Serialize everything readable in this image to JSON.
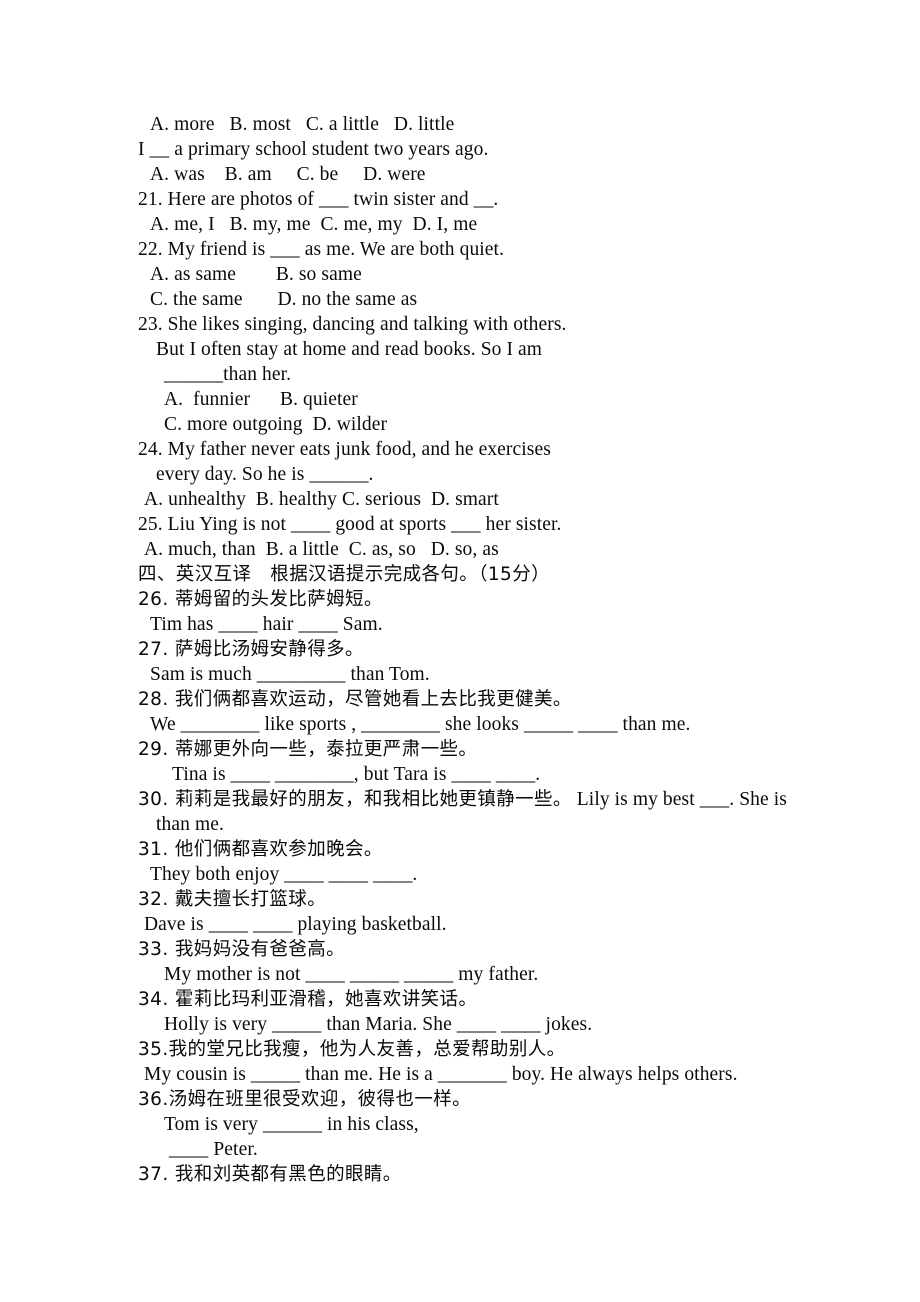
{
  "document": {
    "type": "english-exam-worksheet",
    "page_background": "#ffffff",
    "text_color": "#0a0a0a"
  },
  "lines": [
    {
      "id": "l01",
      "indent": 3,
      "script": "en",
      "text": "A. more   B. most   C. a little   D. little"
    },
    {
      "id": "l02",
      "indent": 1,
      "script": "en",
      "text": "I __ a primary school student two years ago."
    },
    {
      "id": "l03",
      "indent": 3,
      "script": "en",
      "text": "A. was    B. am     C. be     D. were"
    },
    {
      "id": "l04",
      "indent": 1,
      "script": "en",
      "text": "21. Here are photos of ___ twin sister and __."
    },
    {
      "id": "l05",
      "indent": 3,
      "script": "en",
      "text": "A. me, I   B. my, me  C. me, my  D. I, me"
    },
    {
      "id": "l06",
      "indent": 1,
      "script": "en",
      "text": "22. My friend is ___ as me. We are both quiet."
    },
    {
      "id": "l07",
      "indent": 3,
      "script": "en",
      "text": "A. as same        B. so same"
    },
    {
      "id": "l08",
      "indent": 3,
      "script": "en",
      "text": "C. the same       D. no the same as"
    },
    {
      "id": "l09",
      "indent": 1,
      "script": "en",
      "text": "23. She likes singing, dancing and talking with others."
    },
    {
      "id": "l10",
      "indent": 4,
      "script": "en",
      "text": "But I often stay at home and read books. So I am"
    },
    {
      "id": "l11",
      "indent": 5,
      "script": "en",
      "text": "______than her."
    },
    {
      "id": "l12",
      "indent": 5,
      "script": "en",
      "text": "A.  funnier      B. quieter"
    },
    {
      "id": "l13",
      "indent": 5,
      "script": "en",
      "text": "C. more outgoing  D. wilder"
    },
    {
      "id": "l14",
      "indent": 1,
      "script": "en",
      "text": "24. My father never eats junk food, and he exercises"
    },
    {
      "id": "l15",
      "indent": 4,
      "script": "en",
      "text": "every day. So he is ______."
    },
    {
      "id": "l16",
      "indent": 2,
      "script": "en",
      "text": "A. unhealthy  B. healthy C. serious  D. smart"
    },
    {
      "id": "l17",
      "indent": 1,
      "script": "en",
      "text": "25. Liu Ying is not ____ good at sports ___ her sister."
    },
    {
      "id": "l18",
      "indent": 2,
      "script": "en",
      "text": "A. much, than  B. a little  C. as, so   D. so, as"
    },
    {
      "id": "l19",
      "indent": 1,
      "script": "zh",
      "text": "四、英汉互译　根据汉语提示完成各句。（15分）"
    },
    {
      "id": "l20",
      "indent": 1,
      "script": "zh",
      "text": "26. 蒂姆留的头发比萨姆短。"
    },
    {
      "id": "l21",
      "indent": 3,
      "script": "en",
      "text": "Tim has ____ hair ____ Sam."
    },
    {
      "id": "l22",
      "indent": 1,
      "script": "zh",
      "text": "27. 萨姆比汤姆安静得多。"
    },
    {
      "id": "l23",
      "indent": 3,
      "script": "en",
      "text": "Sam is much _________ than Tom."
    },
    {
      "id": "l24",
      "indent": 1,
      "script": "zh",
      "text": "28. 我们俩都喜欢运动，尽管她看上去比我更健美。"
    },
    {
      "id": "l25",
      "indent": 3,
      "script": "en",
      "text": "We ________ like sports , ________ she looks _____ ____ than me."
    },
    {
      "id": "l26",
      "indent": 1,
      "script": "zh",
      "text": "29. 蒂娜更外向一些，泰拉更严肃一些。"
    },
    {
      "id": "l27",
      "indent": 6,
      "script": "en",
      "text": "Tina is ____ ________, but Tara is ____ ____."
    },
    {
      "id": "l28",
      "indent": 1,
      "script": "mixed",
      "zh_text": "30. 莉莉是我最好的朋友，和我相比她更镇静一些。",
      "en_text": " Lily is my best ___. She is"
    },
    {
      "id": "l29",
      "indent": 4,
      "script": "en",
      "text": "than me."
    },
    {
      "id": "l30",
      "indent": 1,
      "script": "zh",
      "text": "31. 他们俩都喜欢参加晚会。"
    },
    {
      "id": "l31",
      "indent": 3,
      "script": "en",
      "text": "They both enjoy ____ ____ ____."
    },
    {
      "id": "l32",
      "indent": 1,
      "script": "zh",
      "text": "32. 戴夫擅长打篮球。"
    },
    {
      "id": "l33",
      "indent": 2,
      "script": "en",
      "text": "Dave is ____ ____ playing basketball."
    },
    {
      "id": "l34",
      "indent": 1,
      "script": "zh",
      "text": "33. 我妈妈没有爸爸高。"
    },
    {
      "id": "l35",
      "indent": 5,
      "script": "en",
      "text": "My mother is not ____ _____ _____ my father."
    },
    {
      "id": "l36",
      "indent": 1,
      "script": "zh",
      "text": "34. 霍莉比玛利亚滑稽，她喜欢讲笑话。"
    },
    {
      "id": "l37",
      "indent": 5,
      "script": "en",
      "text": "Holly is very _____ than Maria. She ____ ____ jokes."
    },
    {
      "id": "l38",
      "indent": 1,
      "script": "zh",
      "text": "35.我的堂兄比我瘦，他为人友善，总爱帮助别人。"
    },
    {
      "id": "l39",
      "indent": 2,
      "script": "en",
      "text": "My cousin is _____ than me. He is a _______ boy. He always helps others."
    },
    {
      "id": "l40",
      "indent": 1,
      "script": "zh",
      "text": "36.汤姆在班里很受欢迎，彼得也一样。"
    },
    {
      "id": "l41",
      "indent": 5,
      "script": "en",
      "text": "Tom is very ______ in his class,"
    },
    {
      "id": "l42",
      "indent": 5,
      "script": "en",
      "text": " ____ Peter."
    },
    {
      "id": "l43",
      "indent": 1,
      "script": "zh",
      "text": "37. 我和刘英都有黑色的眼睛。"
    }
  ]
}
